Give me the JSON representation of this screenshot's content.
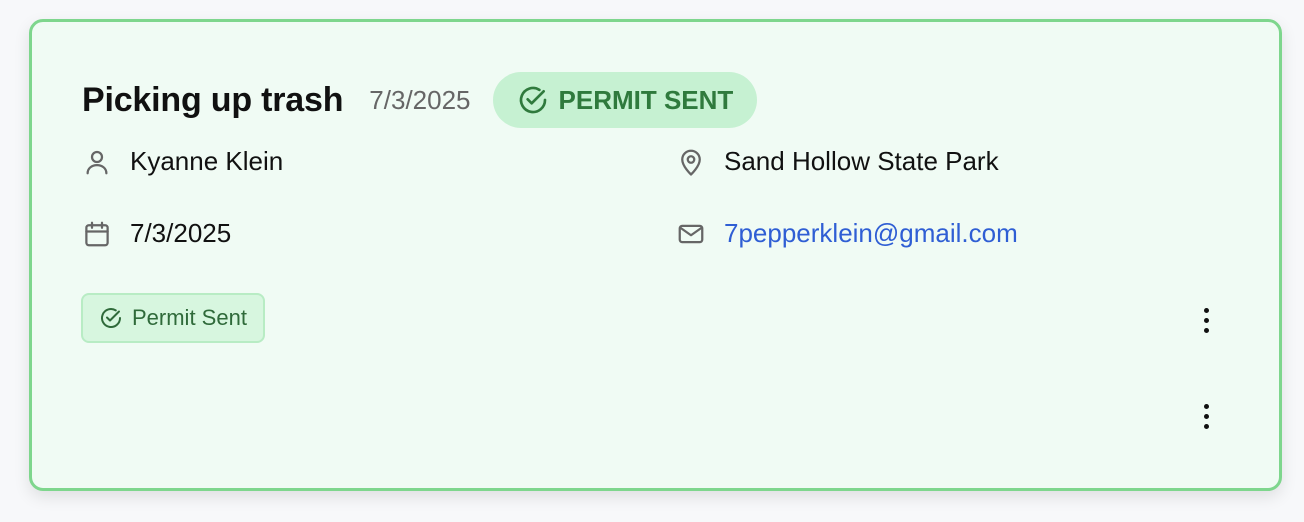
{
  "card": {
    "title": "Picking up trash",
    "date": "7/3/2025",
    "status_label": "PERMIT SENT",
    "status_icon": "check-circle-icon",
    "accent_border": "#7ed68d",
    "background": "#f0fbf4"
  },
  "details": {
    "person": {
      "icon": "user-icon",
      "value": "Kyanne Klein"
    },
    "location": {
      "icon": "map-pin-icon",
      "value": "Sand Hollow State Park"
    },
    "event_date": {
      "icon": "calendar-icon",
      "value": "7/3/2025"
    },
    "email": {
      "icon": "mail-icon",
      "value": "7pepperklein@gmail.com"
    }
  },
  "badge": {
    "label": "Permit Sent",
    "icon": "check-circle-icon"
  },
  "actions": {
    "menu_icon": "more-vertical-icon"
  }
}
